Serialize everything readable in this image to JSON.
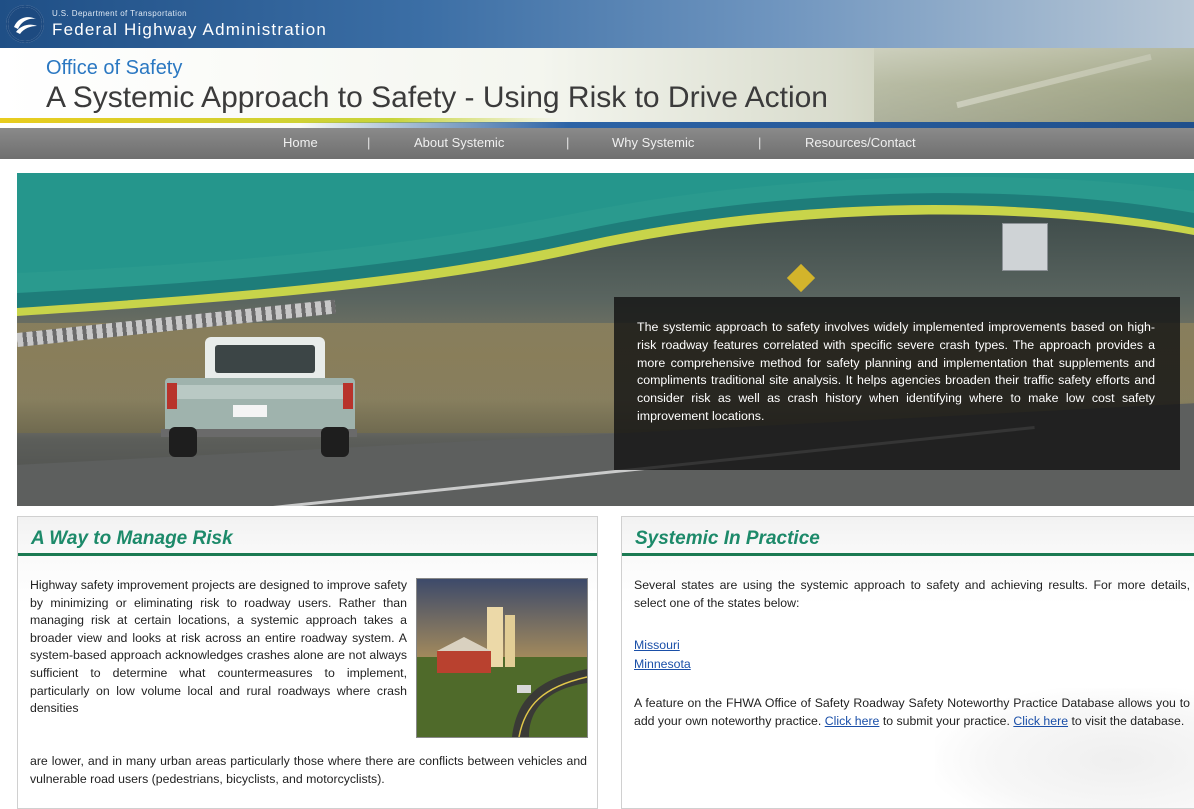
{
  "header": {
    "agency_small": "U.S. Department of Transportation",
    "agency_big": "Federal Highway Administration",
    "office": "Office of Safety",
    "title": "A Systemic Approach to Safety - Using Risk to Drive Action"
  },
  "nav": {
    "items": [
      "Home",
      "About Systemic",
      "Why Systemic",
      "Resources/Contact"
    ],
    "separator": "|"
  },
  "hero": {
    "text": "The systemic approach to safety involves widely implemented improvements based on high-risk roadway features correlated with specific severe crash types. The approach provides a more comprehensive method for safety planning and implementation that supplements and compliments traditional site analysis. It helps agencies broaden their traffic safety efforts and consider risk as well as crash history when identifying where to make low cost safety improvement locations."
  },
  "left_panel": {
    "heading": "A Way to Manage Risk",
    "text_wrap": "Highway safety improvement projects are designed to improve safety by minimizing or eliminating risk to roadway users. Rather than managing risk at certain locations, a systemic approach takes a broader view and looks at risk across an entire roadway system. A system-based approach acknowledges crashes alone are not always sufficient to determine what countermeasures to implement, particularly on low volume local and rural roadways where crash densities",
    "text_full": "are lower, and in many urban areas particularly those where there are conflicts between vehicles and vulnerable road users (pedestrians, bicyclists, and motorcyclists)."
  },
  "right_panel": {
    "heading": "Systemic In Practice",
    "intro": "Several states are using the systemic approach to safety and achieving results. For more details, select one of the states below:",
    "states": [
      "Missouri",
      "Minnesota"
    ],
    "p2_part1": "A feature on the FHWA Office of Safety Roadway Safety Noteworthy Practice Database allows you to add your own noteworthy practice.",
    "link1": "Click here",
    "p2_part2": "to submit your practice.",
    "link2": "Click here",
    "p2_part3": "to visit the database."
  },
  "colors": {
    "heading_green": "#1d8a6a",
    "rule_green": "#1b7a52",
    "link_blue": "#1a4fa8",
    "nav_gray": "#7a7a7a",
    "dot_blue": "#2c5f98"
  }
}
